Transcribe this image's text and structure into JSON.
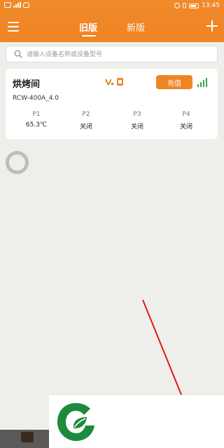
{
  "status_bar": {
    "time": "13:45"
  },
  "header": {
    "tabs": [
      {
        "label": "旧版",
        "active": true
      },
      {
        "label": "新版",
        "active": false
      }
    ],
    "menu_icon": "hamburger-menu-icon",
    "add_icon": "plus-icon"
  },
  "search": {
    "placeholder": "请输入设备名称或设备型号",
    "value": ""
  },
  "device": {
    "name": "烘烤间",
    "model": "RCW-400A_4.0",
    "recharge_label": "充值",
    "ports": [
      {
        "label": "P1",
        "value": "65.3℃"
      },
      {
        "label": "P2",
        "value": "关闭"
      },
      {
        "label": "P3",
        "value": "关闭"
      },
      {
        "label": "P4",
        "value": "关闭"
      }
    ]
  },
  "colors": {
    "header": "#ef8424",
    "accent": "#ef8424",
    "signal": "#3aa547",
    "logo": "#1e8a3c"
  }
}
